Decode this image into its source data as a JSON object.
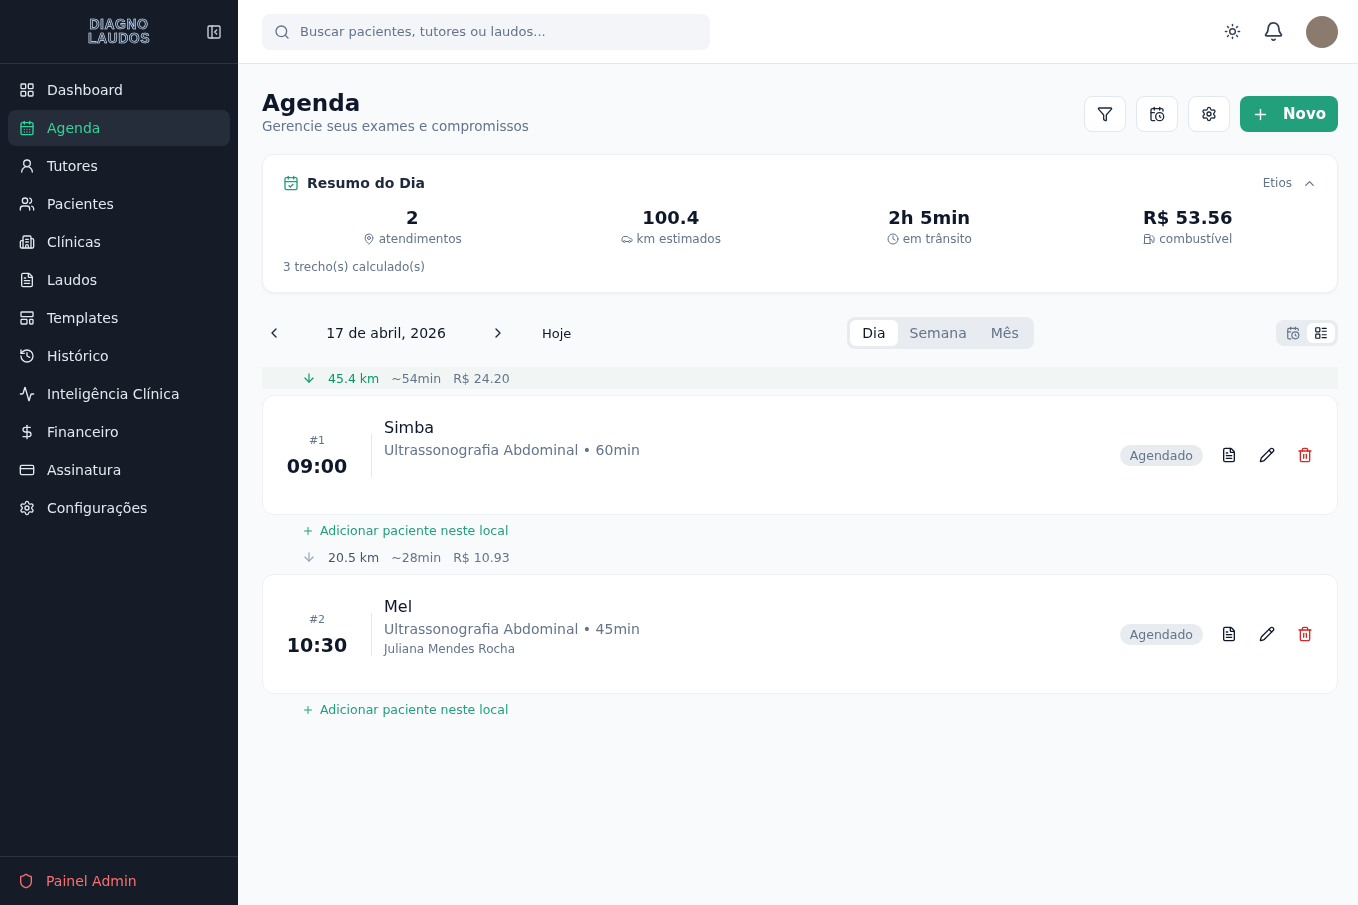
{
  "sidebar": {
    "logo": [
      "DIAGNO",
      "LAUDOS"
    ],
    "items": [
      {
        "label": "Dashboard",
        "selected": false
      },
      {
        "label": "Agenda",
        "selected": true
      },
      {
        "label": "Tutores",
        "selected": false
      },
      {
        "label": "Pacientes",
        "selected": false
      },
      {
        "label": "Clínicas",
        "selected": false
      },
      {
        "label": "Laudos",
        "selected": false
      },
      {
        "label": "Templates",
        "selected": false
      },
      {
        "label": "Histórico",
        "selected": false
      },
      {
        "label": "Inteligência Clínica",
        "selected": false
      },
      {
        "label": "Financeiro",
        "selected": false
      },
      {
        "label": "Assinatura",
        "selected": false
      },
      {
        "label": "Configurações",
        "selected": false
      }
    ],
    "footer": "Painel Admin"
  },
  "search": {
    "placeholder": "Buscar pacientes, tutores ou laudos..."
  },
  "header": {
    "title": "Agenda",
    "subtitle": "Gerencie seus exames e compromissos",
    "new_button": "Novo"
  },
  "summary": {
    "title": "Resumo do Dia",
    "toggle": "Etios",
    "expanded": true,
    "stats": [
      {
        "value": "2",
        "label": "atendimentos"
      },
      {
        "value": "100.4",
        "label": "km estimados"
      },
      {
        "value": "2h 5min",
        "label": "em trânsito"
      },
      {
        "value": "R$ 53.56",
        "label": "combustível"
      }
    ],
    "note": "3 trecho(s) calculado(s)"
  },
  "date_nav": {
    "date": "17 de abril, 2026",
    "today": "Hoje",
    "views": [
      {
        "label": "Dia",
        "selected": true
      },
      {
        "label": "Semana",
        "selected": false
      },
      {
        "label": "Mês",
        "selected": false
      }
    ],
    "layouts": [
      {
        "selected": false
      },
      {
        "selected": true
      }
    ]
  },
  "appointments": [
    {
      "leg": {
        "distance": "45.4 km",
        "time": "~54min",
        "cost": "R$ 24.20",
        "highlighted": true
      },
      "number": "#1",
      "time": "09:00",
      "patient": "Simba",
      "exam": "Ultrassonografia Abdominal • 60min",
      "status": "Agendado",
      "add": "Adicionar paciente neste local"
    },
    {
      "leg": {
        "distance": "20.5 km",
        "time": "~28min",
        "cost": "R$ 10.93",
        "highlighted": false
      },
      "number": "#2",
      "time": "10:30",
      "patient": "Mel",
      "exam": "Ultrassonografia Abdominal • 45min",
      "owner": "Juliana Mendes Rocha",
      "status": "Agendado",
      "add": "Adicionar paciente neste local"
    }
  ]
}
